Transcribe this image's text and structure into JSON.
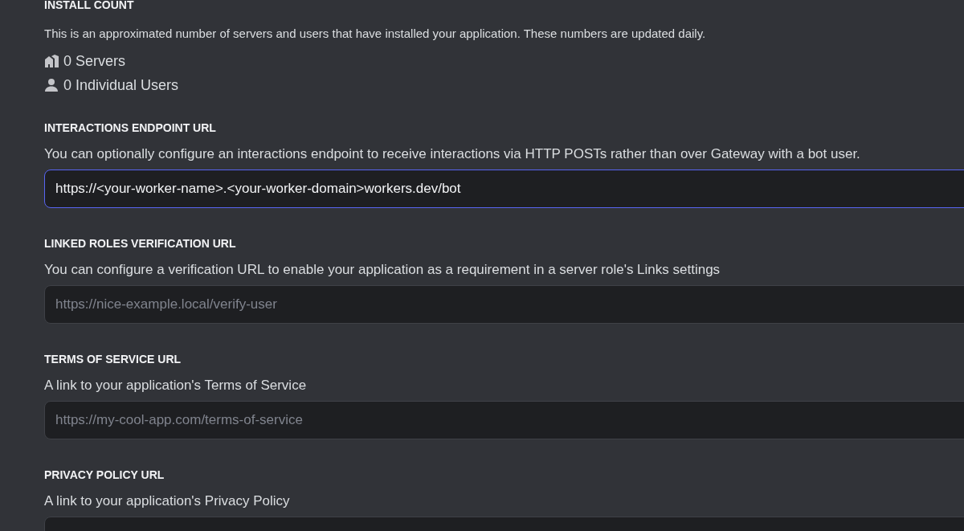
{
  "install_count": {
    "heading": "INSTALL COUNT",
    "description": "This is an approximated number of servers and users that have installed your application. These numbers are updated daily.",
    "stats": [
      {
        "kind": "servers",
        "label": "0 Servers"
      },
      {
        "kind": "users",
        "label": "0 Individual Users"
      }
    ]
  },
  "url_fields": [
    {
      "heading": "INTERACTIONS ENDPOINT URL",
      "description": "You can optionally configure an interactions endpoint to receive interactions via HTTP POSTs rather than over Gateway with a bot user.",
      "value": "https://<your-worker-name>.<your-worker-domain>workers.dev/bot",
      "focused": true
    },
    {
      "heading": "LINKED ROLES VERIFICATION URL",
      "description": "You can configure a verification URL to enable your application as a requirement in a server role's Links settings",
      "placeholder": "https://nice-example.local/verify-user",
      "focused": false
    },
    {
      "heading": "TERMS OF SERVICE URL",
      "description": "A link to your application's Terms of Service",
      "placeholder": "https://my-cool-app.com/terms-of-service",
      "focused": false
    },
    {
      "heading": "PRIVACY POLICY URL",
      "description": "A link to your application's Privacy Policy",
      "focused": false
    }
  ]
}
